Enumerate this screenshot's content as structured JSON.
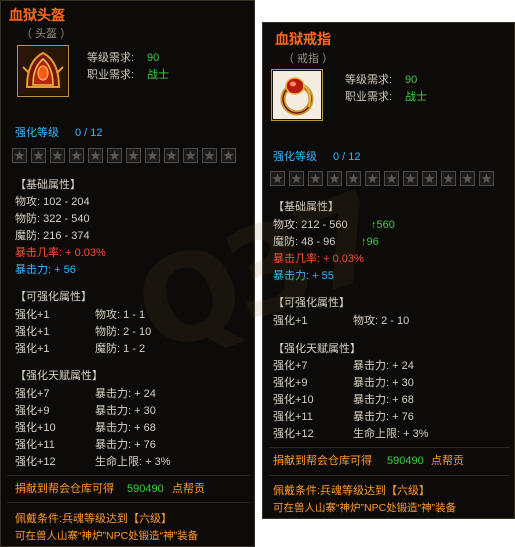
{
  "helmet": {
    "title": "血狱头盔",
    "subtitle": "（ 头盔 ）",
    "icon": "helmet-icon",
    "level_req_label": "等级需求:",
    "level_req_value": "90",
    "class_req_label": "职业需求:",
    "class_req_value": "战士",
    "enhance_label": "强化等级",
    "enhance_value": "0 / 12",
    "base_header": "【基础属性】",
    "base": [
      {
        "text": "物攻: 102 - 204",
        "color": "normal"
      },
      {
        "text": "物防: 322 - 540",
        "color": "normal"
      },
      {
        "text": "魔防: 216 - 374",
        "color": "normal"
      },
      {
        "text": "暴击几率: + 0.03%",
        "color": "red"
      },
      {
        "text": "暴击力: + 56",
        "color": "blue"
      }
    ],
    "enh_header": "【可强化属性】",
    "enh": [
      {
        "lvl": "强化+1",
        "attr": "物攻: 1 - 1"
      },
      {
        "lvl": "强化+1",
        "attr": "物防: 2 - 10"
      },
      {
        "lvl": "强化+1",
        "attr": "魔防: 1 - 2"
      }
    ],
    "talent_header": "【强化天赋属性】",
    "talent": [
      {
        "lvl": "强化+7",
        "attr": "暴击力: + 24"
      },
      {
        "lvl": "强化+9",
        "attr": "暴击力: + 30"
      },
      {
        "lvl": "强化+10",
        "attr": "暴击力: + 68"
      },
      {
        "lvl": "强化+11",
        "attr": "暴击力: + 76"
      },
      {
        "lvl": "强化+12",
        "attr": "生命上限: + 3%"
      }
    ],
    "donate_label": "捐献到帮会仓库可得",
    "donate_value": "590490",
    "donate_unit": "点帮贡",
    "wear_cond": "佩戴条件:兵魂等级达到【六级】",
    "forge_note": "可在兽人山寨“神炉”NPC处锻造“神”装备"
  },
  "ring": {
    "title": "血狱戒指",
    "subtitle": "（ 戒指 ）",
    "icon": "ring-icon",
    "level_req_label": "等级需求:",
    "level_req_value": "90",
    "class_req_label": "职业需求:",
    "class_req_value": "战士",
    "enhance_label": "强化等级",
    "enhance_value": "0 / 12",
    "base_header": "【基础属性】",
    "base": [
      {
        "text": "物攻: 212 - 560",
        "color": "normal",
        "up": "560"
      },
      {
        "text": "魔防: 48 - 96",
        "color": "normal",
        "up": "96"
      },
      {
        "text": "暴击几率: + 0.03%",
        "color": "red"
      },
      {
        "text": "暴击力: + 55",
        "color": "blue"
      }
    ],
    "enh_header": "【可强化属性】",
    "enh": [
      {
        "lvl": "强化+1",
        "attr": "物攻: 2 - 10"
      }
    ],
    "talent_header": "【强化天赋属性】",
    "talent": [
      {
        "lvl": "强化+7",
        "attr": "暴击力: + 24"
      },
      {
        "lvl": "强化+9",
        "attr": "暴击力: + 30"
      },
      {
        "lvl": "强化+10",
        "attr": "暴击力: + 68"
      },
      {
        "lvl": "强化+11",
        "attr": "暴击力: + 76"
      },
      {
        "lvl": "强化+12",
        "attr": "生命上限: + 3%"
      }
    ],
    "donate_label": "捐献到帮会仓库可得",
    "donate_value": "590490",
    "donate_unit": "点帮贡",
    "wear_cond": "佩戴条件:兵魂等级达到【六级】",
    "forge_note": "可在兽人山寨“神炉”NPC处锻造“神”装备"
  },
  "watermark": "Q37",
  "colors": {
    "title": "#ff6a1e",
    "green": "#3bd03b",
    "blue": "#3ab4ff",
    "red": "#ff4a38",
    "orange": "#ff9a2a",
    "border": "#3a3125"
  }
}
